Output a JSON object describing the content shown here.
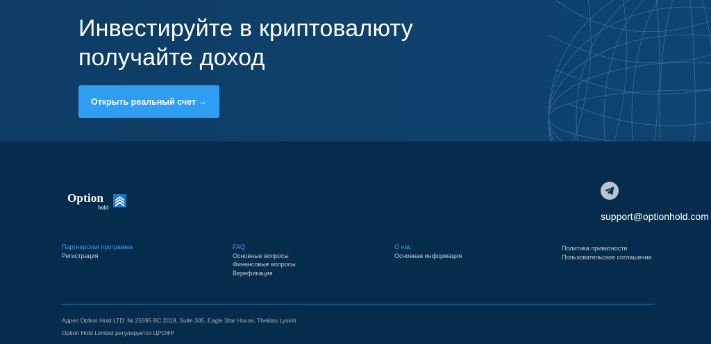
{
  "hero": {
    "title_line1": "Инвестируйте в криптовалюту",
    "title_line2": "получайте доход",
    "cta_label": "Открыть реальный счет →"
  },
  "logo": {
    "word": "Option",
    "sub": "hold"
  },
  "contact": {
    "icon": "telegram-icon",
    "email": "support@optionhold.com"
  },
  "footer_columns": [
    {
      "heading": "Партнерская программа",
      "links": [
        "Регистрация"
      ]
    },
    {
      "heading": "FAQ",
      "links": [
        "Основные вопросы",
        "Финансовые вопросы",
        "Верефикация"
      ]
    },
    {
      "heading": "О нас",
      "links": [
        "Основная информация"
      ]
    },
    {
      "heading": "",
      "links": [
        "Политика приватности",
        "Пользовательское соглашение"
      ]
    }
  ],
  "legal": {
    "address": "Адрес Option Hold LTD: № 25595 BC 2019, Suite 305, Eagle Star House, Theklas Lysioti",
    "regulated": "Option Hold Limited регулируется ЦРОФР"
  },
  "colors": {
    "hero_bg": "#0e416b",
    "footer_bg": "#052c4c",
    "accent": "#2f9df2",
    "link_heading": "#3aa0ee"
  }
}
